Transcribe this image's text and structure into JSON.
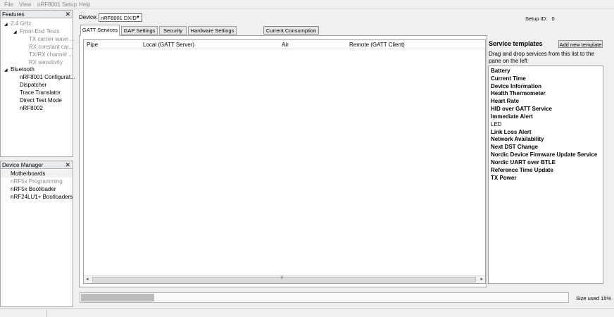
{
  "menu": [
    "File",
    "View",
    "nRF8001 Setup",
    "Help"
  ],
  "features": {
    "title": "Features",
    "close_glyph": "✕",
    "items": [
      {
        "label": "2.4 GHz",
        "gray": true,
        "expander": true
      },
      {
        "label": "Front-End Tests",
        "gray": true,
        "expander": true
      },
      {
        "label": "TX carrier wave ...",
        "gray": true
      },
      {
        "label": "RX constant car...",
        "gray": true
      },
      {
        "label": "TX/RX channel ...",
        "gray": true
      },
      {
        "label": "RX sensitivity",
        "gray": true
      },
      {
        "label": "Bluetooth",
        "gray": false,
        "expander": true
      },
      {
        "label": "nRF8001 Configurat...",
        "gray": false
      },
      {
        "label": "Dispatcher",
        "gray": false
      },
      {
        "label": "Trace Translator",
        "gray": false
      },
      {
        "label": "Direct Test Mode",
        "gray": false
      },
      {
        "label": "nRF8002",
        "gray": false
      }
    ]
  },
  "device_manager": {
    "title": "Device Manager",
    "close_glyph": "✕",
    "items": [
      {
        "label": "Motherboards",
        "gray": false
      },
      {
        "label": "nRF5x Programming",
        "gray": true
      },
      {
        "label": "nRF5x Bootloader",
        "gray": false
      },
      {
        "label": "nRF24LU1+ Bootloaders",
        "gray": false
      }
    ]
  },
  "device": {
    "label": "Device:",
    "selected": "nRF8001 DX/D",
    "arrow": "▼"
  },
  "setup_id": {
    "label": "Setup ID:",
    "value": "0"
  },
  "tabs": [
    "GATT Services",
    "GAP Settings",
    "Security",
    "Hardware Settings"
  ],
  "current_consumption_button": "Current Consumption",
  "pipe_table": {
    "columns": [
      "Pipe",
      "Local (GATT Server)",
      "Air",
      "Remote (GATT Client)"
    ],
    "scroll_left": "◂",
    "scroll_right": "▸",
    "scroll_grip": "⦀"
  },
  "service_templates": {
    "title": "Service templates",
    "add_button": "Add new template",
    "description": "Drag and drop services from this list to the pane on the left",
    "items": [
      {
        "label": "Battery",
        "bold": true
      },
      {
        "label": "Current Time",
        "bold": true
      },
      {
        "label": "Device Information",
        "bold": true
      },
      {
        "label": "Health Thermometer",
        "bold": true
      },
      {
        "label": "Heart Rate",
        "bold": true
      },
      {
        "label": "HID over GATT Service",
        "bold": true
      },
      {
        "label": "Immediate Alert",
        "bold": true
      },
      {
        "label": "LED",
        "bold": false
      },
      {
        "label": "Link Loss Alert",
        "bold": true
      },
      {
        "label": "Network Availability",
        "bold": true
      },
      {
        "label": "Next DST Change",
        "bold": true
      },
      {
        "label": "Nordic Device Firmware Update Service",
        "bold": true
      },
      {
        "label": "Nordic UART over BTLE",
        "bold": true
      },
      {
        "label": "Reference Time Update",
        "bold": true
      },
      {
        "label": "TX Power",
        "bold": true
      }
    ]
  },
  "size": {
    "label": "Size used 15%",
    "fraction": 0.15
  }
}
